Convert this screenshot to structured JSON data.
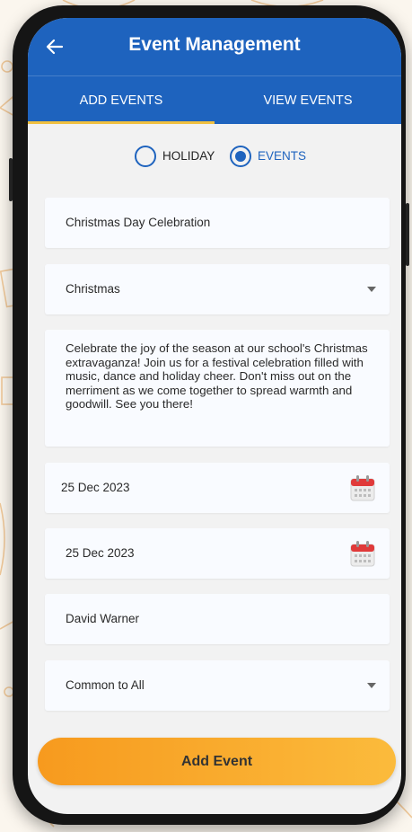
{
  "appbar": {
    "title": "Event Management",
    "back_icon": "arrow-left-icon"
  },
  "tabs": [
    {
      "label": "ADD EVENTS",
      "active": true
    },
    {
      "label": "VIEW EVENTS",
      "active": false
    }
  ],
  "type_options": [
    {
      "label": "HOLIDAY",
      "selected": false
    },
    {
      "label": "EVENTS",
      "selected": true
    }
  ],
  "form": {
    "event_name": "Christmas Day Celebration",
    "category": "Christmas",
    "description": "Celebrate the joy of the season at our school's Christmas extravaganza! Join us for a festival celebration filled with music, dance and holiday cheer. Don't miss out on the merriment as we come together to spread warmth and goodwill. See you there!",
    "start_date": "25 Dec 2023",
    "end_date": "25 Dec 2023",
    "organizer": "David Warner",
    "audience": "Common to All"
  },
  "submit_label": "Add Event",
  "colors": {
    "primary": "#1e63be",
    "tab_indicator": "#f0c040",
    "button_start": "#f79a1e",
    "button_end": "#fbbb3c"
  }
}
